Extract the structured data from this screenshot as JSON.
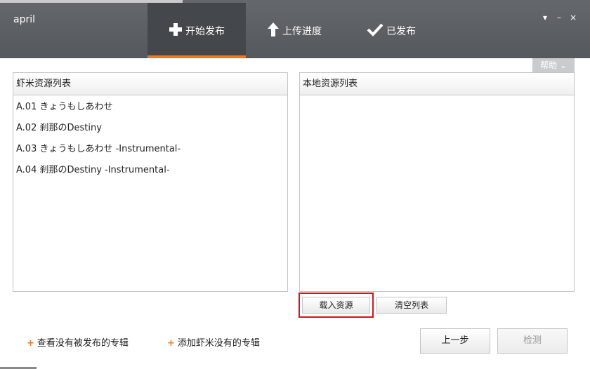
{
  "header": {
    "app_title": "april",
    "tabs": [
      {
        "label": "开始发布",
        "icon": "plus-icon",
        "active": true
      },
      {
        "label": "上传进度",
        "icon": "arrow-up-icon",
        "active": false
      },
      {
        "label": "已发布",
        "icon": "checkmark-icon",
        "active": false
      }
    ],
    "window_controls": {
      "menu": "▾",
      "minimize": "–",
      "close": "×"
    },
    "accent_color": "#f07a1b"
  },
  "help": {
    "label": "帮助 ⌄"
  },
  "left_panel": {
    "title": "虾米资源列表",
    "items": [
      "A.01  きょうもしあわせ",
      "A.02  刹那のDestiny",
      "A.03  きょうもしあわせ -Instrumental-",
      "A.04  刹那のDestiny -Instrumental-"
    ]
  },
  "right_panel": {
    "title": "本地资源列表",
    "items": []
  },
  "actions": {
    "load_label": "载入资源",
    "clear_label": "清空列表",
    "prev_label": "上一步",
    "detect_label": "检测"
  },
  "links": {
    "unpublished_albums": "查看没有被发布的专辑",
    "add_missing_album": "添加虾米没有的专辑"
  },
  "colors": {
    "highlight": "#d4141c"
  }
}
